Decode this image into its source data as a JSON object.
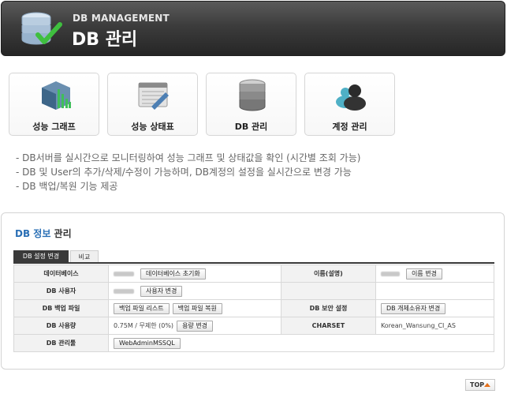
{
  "header": {
    "subtitle": "DB MANAGEMENT",
    "title": "DB 관리"
  },
  "menu": [
    {
      "label": "성능 그래프",
      "icon": "performance-graph-icon"
    },
    {
      "label": "성능 상태표",
      "icon": "performance-status-icon"
    },
    {
      "label": "DB 관리",
      "icon": "database-icon"
    },
    {
      "label": "계정 관리",
      "icon": "account-icon"
    }
  ],
  "description": [
    "- DB서버를 실시간으로 모니터링하여 성능 그래프 및 상태값을 확인 (시간별 조회 가능)",
    "- DB 및 User의 추가/삭제/수정이 가능하며, DB계정의 설정을 실시간으로 변경 가능",
    "- DB 백업/복원 기능 제공"
  ],
  "panel": {
    "title_highlight": "DB 정보",
    "title_rest": " 관리",
    "tabs": [
      "DB 설정 변경",
      "비교"
    ],
    "rows": {
      "db": {
        "label": "데이터베이스",
        "button": "데이터베이스 초기화"
      },
      "name": {
        "label": "이름(설명)",
        "button": "이름 변경"
      },
      "user": {
        "label": "DB 사용자",
        "button": "사용자 변경"
      },
      "backup": {
        "label": "DB 백업 파일",
        "button1": "백업 파일 리스트",
        "button2": "백업 파일 복원"
      },
      "security": {
        "label": "DB 보안 설정",
        "button": "DB 개체소유자 변경"
      },
      "usage": {
        "label": "DB 사용량",
        "value": "0.75M / 무제한 (0%)",
        "button": "용량 변경"
      },
      "charset": {
        "label": "CHARSET",
        "value": "Korean_Wansung_CI_AS"
      },
      "tool": {
        "label": "DB 관리툴",
        "button": "WebAdminMSSQL"
      }
    }
  },
  "top_button": "TOP",
  "colors": {
    "accent_blue": "#2a6fb5",
    "header_dark": "#3c3c3c",
    "top_arrow": "#e5701a"
  }
}
